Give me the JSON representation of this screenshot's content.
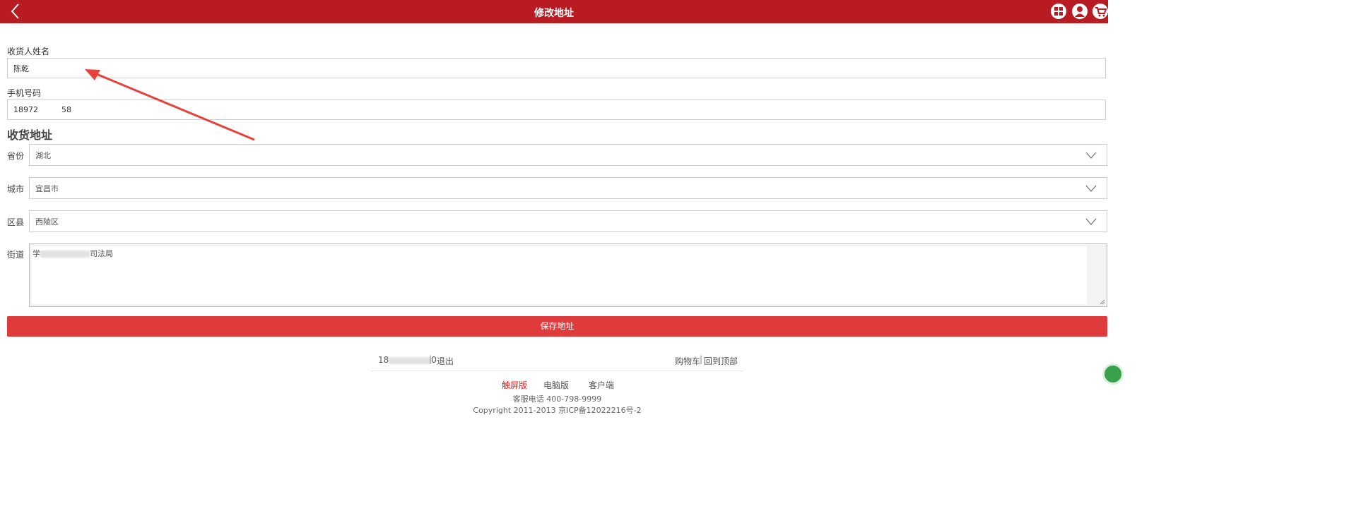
{
  "header": {
    "title": "修改地址",
    "accent_color": "#b81c22",
    "icons": [
      "back-arrow-icon",
      "grid-menu-icon",
      "user-icon",
      "cart-icon"
    ]
  },
  "form": {
    "name_label": "收货人姓名",
    "name_value": "陈乾",
    "phone_label": "手机号码",
    "phone_value": "18972   58",
    "address_section_title": "收货地址",
    "province_label": "省份",
    "province_value": "湖北",
    "city_label": "城市",
    "city_value": "宜昌市",
    "district_label": "区县",
    "district_value": "西陵区",
    "street_label": "街道",
    "street_value_start": "学",
    "street_value_end": "司法局",
    "save_label": "保存地址",
    "button_color": "#df3b3d"
  },
  "footer": {
    "account_prefix": "18",
    "account_suffix": "0",
    "separator": "|",
    "logout": "退出",
    "cart": "购物车",
    "back_to_top": "回到顶部",
    "version_touch": "触屏版",
    "version_pc": "电脑版",
    "version_client": "客户端",
    "hotline": "客服电话 400-798-9999",
    "copyright": "Copyright 2011-2013 京ICP备12022216号-2",
    "active_color": "#d9252b"
  }
}
